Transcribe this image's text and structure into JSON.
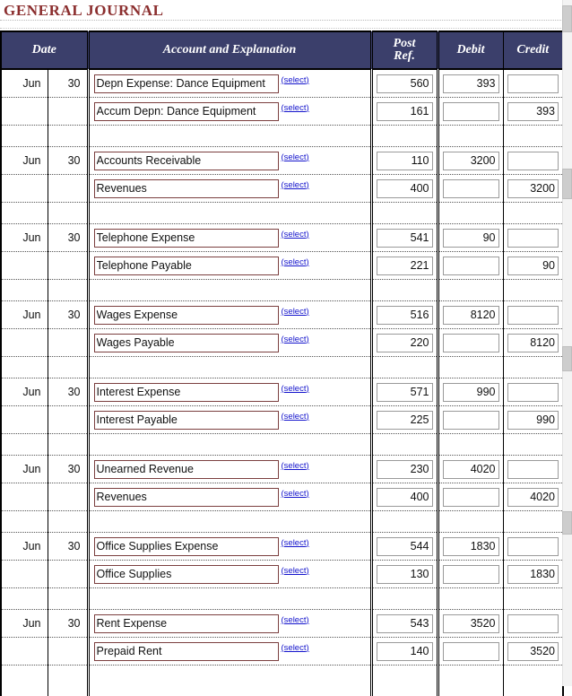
{
  "page": {
    "title": "GENERAL JOURNAL"
  },
  "table": {
    "headers": {
      "date": "Date",
      "account": "Account and Explanation",
      "post_ref_line1": "Post",
      "post_ref_line2": "Ref.",
      "debit": "Debit",
      "credit": "Credit"
    },
    "select_link_label": "(select)",
    "entries": [
      {
        "month": "Jun",
        "day": "30",
        "lines": [
          {
            "account": "Depn Expense: Dance Equipment",
            "post_ref": "560",
            "debit": "393",
            "credit": ""
          },
          {
            "account": "Accum Depn: Dance Equipment",
            "post_ref": "161",
            "debit": "",
            "credit": "393"
          }
        ]
      },
      {
        "month": "Jun",
        "day": "30",
        "lines": [
          {
            "account": "Accounts Receivable",
            "post_ref": "110",
            "debit": "3200",
            "credit": ""
          },
          {
            "account": "Revenues",
            "post_ref": "400",
            "debit": "",
            "credit": "3200"
          }
        ]
      },
      {
        "month": "Jun",
        "day": "30",
        "lines": [
          {
            "account": "Telephone Expense",
            "post_ref": "541",
            "debit": "90",
            "credit": ""
          },
          {
            "account": "Telephone Payable",
            "post_ref": "221",
            "debit": "",
            "credit": "90"
          }
        ]
      },
      {
        "month": "Jun",
        "day": "30",
        "lines": [
          {
            "account": "Wages Expense",
            "post_ref": "516",
            "debit": "8120",
            "credit": ""
          },
          {
            "account": "Wages Payable",
            "post_ref": "220",
            "debit": "",
            "credit": "8120"
          }
        ]
      },
      {
        "month": "Jun",
        "day": "30",
        "lines": [
          {
            "account": "Interest Expense",
            "post_ref": "571",
            "debit": "990",
            "credit": ""
          },
          {
            "account": "Interest Payable",
            "post_ref": "225",
            "debit": "",
            "credit": "990"
          }
        ]
      },
      {
        "month": "Jun",
        "day": "30",
        "lines": [
          {
            "account": "Unearned Revenue",
            "post_ref": "230",
            "debit": "4020",
            "credit": ""
          },
          {
            "account": "Revenues",
            "post_ref": "400",
            "debit": "",
            "credit": "4020"
          }
        ]
      },
      {
        "month": "Jun",
        "day": "30",
        "lines": [
          {
            "account": "Office Supplies Expense",
            "post_ref": "544",
            "debit": "1830",
            "credit": ""
          },
          {
            "account": "Office Supplies",
            "post_ref": "130",
            "debit": "",
            "credit": "1830"
          }
        ]
      },
      {
        "month": "Jun",
        "day": "30",
        "lines": [
          {
            "account": "Rent Expense",
            "post_ref": "543",
            "debit": "3520",
            "credit": ""
          },
          {
            "account": "Prepaid Rent",
            "post_ref": "140",
            "debit": "",
            "credit": "3520"
          }
        ]
      }
    ]
  },
  "colors": {
    "title": "#8B2E2E",
    "header_bg": "#3B3F6B",
    "header_text": "#FFFFFF",
    "account_input_border": "#7B3F3F",
    "numeric_input_border": "#9A9A9A",
    "link": "#1414CC"
  }
}
